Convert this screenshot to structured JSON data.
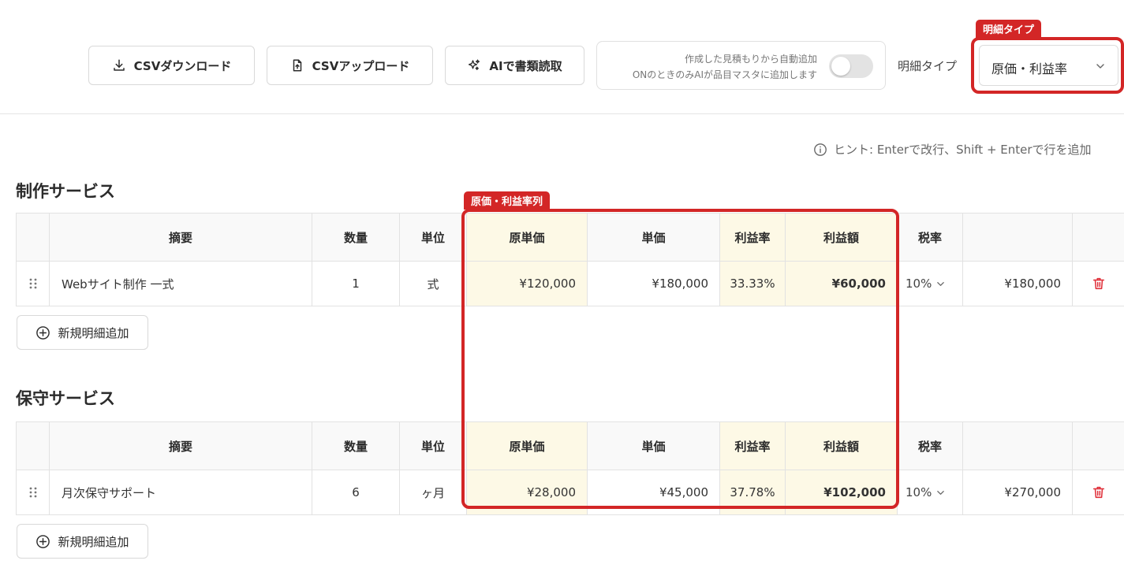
{
  "toolbar": {
    "csv_download": "CSVダウンロード",
    "csv_upload": "CSVアップロード",
    "ai_read": "AIで書類読取",
    "auto_add_line1": "作成した見積もりから自動追加",
    "auto_add_line2": "ONのときのみAIが品目マスタに追加します",
    "auto_add_on": false,
    "type_label": "明細タイプ",
    "type_value": "原価・利益率"
  },
  "annotations": {
    "type_tag": "明細タイプ",
    "cost_tag": "原価・利益率列"
  },
  "hint": "ヒント: Enterで改行、Shift + Enterで行を追加",
  "columns": {
    "desc": "摘要",
    "qty": "数量",
    "unit": "単位",
    "cost": "原単価",
    "price": "単価",
    "margin_rate": "利益率",
    "margin_amount": "利益額",
    "tax": "税率"
  },
  "sections": [
    {
      "title": "制作サービス",
      "add_label": "新規明細追加",
      "rows": [
        {
          "desc": "Webサイト制作 一式",
          "qty": "1",
          "unit": "式",
          "cost": "¥120,000",
          "price": "¥180,000",
          "margin_rate": "33.33%",
          "margin_amount": "¥60,000",
          "tax": "10%",
          "amount": "¥180,000"
        }
      ]
    },
    {
      "title": "保守サービス",
      "add_label": "新規明細追加",
      "rows": [
        {
          "desc": "月次保守サポート",
          "qty": "6",
          "unit": "ヶ月",
          "cost": "¥28,000",
          "price": "¥45,000",
          "margin_rate": "37.78%",
          "margin_amount": "¥102,000",
          "tax": "10%",
          "amount": "¥270,000"
        }
      ]
    }
  ],
  "colors": {
    "accent_red": "#d32626",
    "cost_column_bg": "#fdf9e6",
    "delete_icon": "#e0303a"
  }
}
